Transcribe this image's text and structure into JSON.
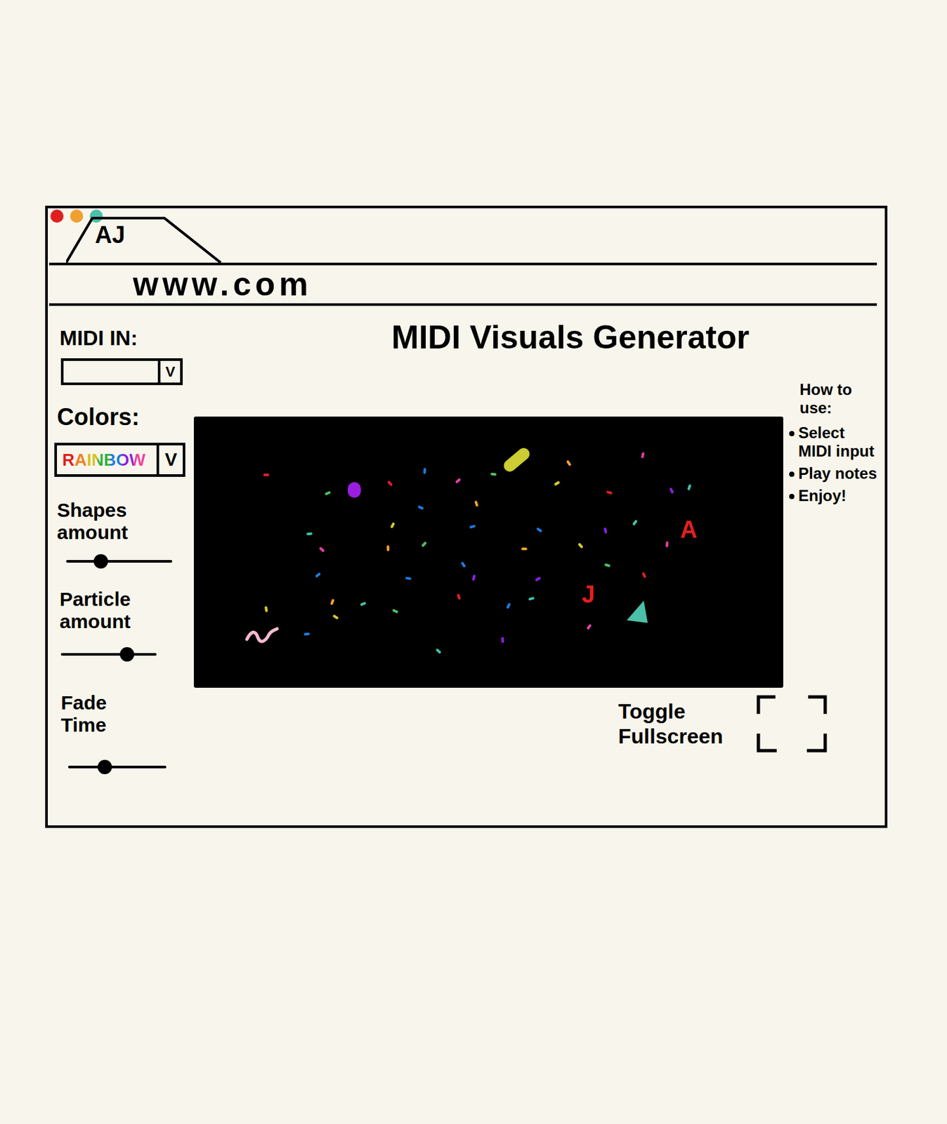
{
  "browser": {
    "controls": [
      {
        "color": "#e0201e"
      },
      {
        "color": "#f0a030"
      },
      {
        "color": "#4cc0a8"
      }
    ],
    "tab": {
      "label": "AJ"
    },
    "url": "www.com"
  },
  "sidebar": {
    "midi_in": {
      "label": "MIDI IN:",
      "value": "",
      "arrow": "V"
    },
    "colors": {
      "label": "Colors:",
      "value": "RAINBOW",
      "arrow": "V",
      "value_colors": [
        "#e0201e",
        "#f08020",
        "#d8c020",
        "#30b040",
        "#1e7be0",
        "#8a20e0",
        "#f040a0"
      ]
    },
    "sliders": [
      {
        "label": "Shapes amount",
        "level": 0.33
      },
      {
        "label": "Particle amount",
        "level": 0.69
      },
      {
        "label": "Fade Time",
        "level": 0.37
      }
    ]
  },
  "title": "MIDI Visuals Generator",
  "canvas": {
    "shapes": [
      {
        "kind": "capsule",
        "color": "#cccc33"
      },
      {
        "kind": "circle",
        "color": "#9b1de0"
      },
      {
        "kind": "letter",
        "text": "A",
        "color": "#e0201e"
      },
      {
        "kind": "letter",
        "text": "J",
        "color": "#e0201e"
      },
      {
        "kind": "triangle",
        "color": "#4cbfa8"
      },
      {
        "kind": "squiggle",
        "color": "#f7b8d0"
      }
    ],
    "particles": [
      {
        "color": "#e0201e"
      },
      {
        "color": "#e0201e"
      },
      {
        "color": "#1e7be0"
      },
      {
        "color": "#e040a0"
      },
      {
        "color": "#4cc060"
      },
      {
        "color": "#f0a030"
      },
      {
        "color": "#e040a0"
      },
      {
        "color": "#d8c830"
      },
      {
        "color": "#e0201e"
      },
      {
        "color": "#8a20e0"
      },
      {
        "color": "#40c0a8"
      },
      {
        "color": "#4cc060"
      },
      {
        "color": "#1e7be0"
      },
      {
        "color": "#f0a030"
      },
      {
        "color": "#d8c830"
      },
      {
        "color": "#1e7be0"
      },
      {
        "color": "#1e7be0"
      },
      {
        "color": "#8a20e0"
      },
      {
        "color": "#40c0a8"
      },
      {
        "color": "#40c0a8"
      },
      {
        "color": "#e040a0"
      },
      {
        "color": "#f0a030"
      },
      {
        "color": "#4cc060"
      },
      {
        "color": "#f0a030"
      },
      {
        "color": "#d8c830"
      },
      {
        "color": "#e040a0"
      },
      {
        "color": "#1e7be0"
      },
      {
        "color": "#1e7be0"
      },
      {
        "color": "#1e7be0"
      },
      {
        "color": "#8a20e0"
      },
      {
        "color": "#8a20e0"
      },
      {
        "color": "#4cc060"
      },
      {
        "color": "#e0201e"
      },
      {
        "color": "#f0a030"
      },
      {
        "color": "#40c0a8"
      },
      {
        "color": "#4cc060"
      },
      {
        "color": "#e0201e"
      },
      {
        "color": "#1e7be0"
      },
      {
        "color": "#40c0a8"
      },
      {
        "color": "#d8c830"
      },
      {
        "color": "#d8c830"
      },
      {
        "color": "#e040a0"
      },
      {
        "color": "#1e7be0"
      },
      {
        "color": "#40c0a8"
      },
      {
        "color": "#8a20e0"
      }
    ]
  },
  "help": {
    "title": "How to use:",
    "steps": [
      "Select MIDI input",
      "Play notes",
      "Enjoy!"
    ]
  },
  "fullscreen": {
    "label": "Toggle Fullscreen"
  }
}
